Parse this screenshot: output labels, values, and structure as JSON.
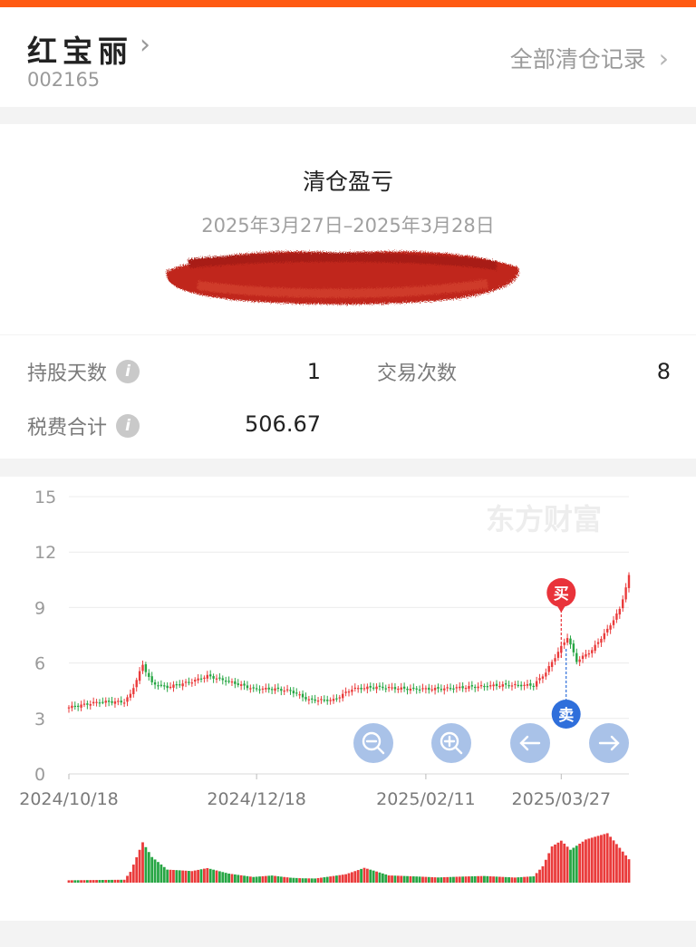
{
  "header": {
    "stock_name": "红宝丽",
    "stock_code": "002165",
    "all_records_label": "全部清仓记录"
  },
  "summary": {
    "title": "清仓盈亏",
    "date_range": "2025年3月27日–2025年3月28日"
  },
  "stats": {
    "hold_days_label": "持股天数",
    "hold_days_value": "1",
    "trade_count_label": "交易次数",
    "trade_count_value": "8",
    "fees_label": "税费合计",
    "fees_value": "506.67"
  },
  "watermark": "东方财富",
  "markers": {
    "buy": "买",
    "sell": "卖"
  },
  "colors": {
    "up": "#ea3b3b",
    "down": "#27a644",
    "accent": "#ff5a12",
    "buy_marker": "#e9333a",
    "sell_marker": "#2f6fdb",
    "nav_button": "#a9c2e8"
  },
  "chart_data": {
    "type": "candlestick",
    "y_ticks": [
      0,
      3,
      6,
      9,
      12,
      15
    ],
    "ylim": [
      0,
      15
    ],
    "x_tick_labels": [
      "2024/10/18",
      "2024/12/18",
      "2025/02/11",
      "2025/03/27"
    ],
    "x_tick_days": [
      0,
      61,
      116,
      160
    ],
    "x_range_days": [
      0,
      182
    ],
    "buy_day": 160,
    "sell_day": 161,
    "price_anchors": [
      [
        0,
        3.6
      ],
      [
        10,
        3.9
      ],
      [
        18,
        3.9
      ],
      [
        20,
        4.3
      ],
      [
        24,
        5.9
      ],
      [
        27,
        4.9
      ],
      [
        32,
        4.7
      ],
      [
        40,
        5.0
      ],
      [
        45,
        5.3
      ],
      [
        52,
        5.0
      ],
      [
        60,
        4.6
      ],
      [
        66,
        4.6
      ],
      [
        72,
        4.5
      ],
      [
        78,
        4.0
      ],
      [
        86,
        4.0
      ],
      [
        92,
        4.6
      ],
      [
        100,
        4.7
      ],
      [
        110,
        4.6
      ],
      [
        120,
        4.6
      ],
      [
        130,
        4.7
      ],
      [
        140,
        4.8
      ],
      [
        151,
        4.8
      ],
      [
        155,
        5.5
      ],
      [
        159,
        6.6
      ],
      [
        162,
        7.4
      ],
      [
        165,
        6.1
      ],
      [
        170,
        6.7
      ],
      [
        175,
        7.8
      ],
      [
        179,
        8.9
      ],
      [
        182,
        10.7
      ]
    ],
    "volume_anchors": [
      [
        0,
        0.06
      ],
      [
        18,
        0.06
      ],
      [
        20,
        0.22
      ],
      [
        24,
        0.8
      ],
      [
        27,
        0.5
      ],
      [
        32,
        0.25
      ],
      [
        40,
        0.22
      ],
      [
        45,
        0.28
      ],
      [
        52,
        0.18
      ],
      [
        60,
        0.12
      ],
      [
        66,
        0.16
      ],
      [
        72,
        0.12
      ],
      [
        80,
        0.1
      ],
      [
        90,
        0.18
      ],
      [
        96,
        0.3
      ],
      [
        104,
        0.14
      ],
      [
        120,
        0.1
      ],
      [
        135,
        0.14
      ],
      [
        145,
        0.12
      ],
      [
        151,
        0.16
      ],
      [
        154,
        0.4
      ],
      [
        157,
        0.85
      ],
      [
        160,
        0.95
      ],
      [
        163,
        0.72
      ],
      [
        168,
        0.9
      ],
      [
        175,
        0.98
      ],
      [
        182,
        0.45
      ]
    ]
  }
}
